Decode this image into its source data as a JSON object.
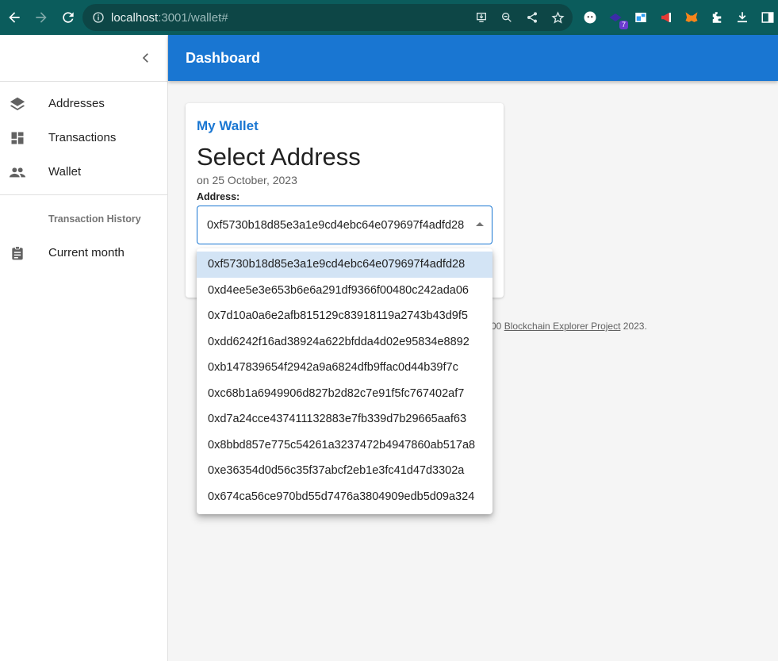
{
  "browser": {
    "url_host": "localhost",
    "url_rest": ":3001/wallet#",
    "extension_badge": "7"
  },
  "sidebar": {
    "items": [
      {
        "label": "Addresses",
        "icon": "layers-icon"
      },
      {
        "label": "Transactions",
        "icon": "dashboard-icon"
      },
      {
        "label": "Wallet",
        "icon": "people-icon"
      }
    ],
    "subheader": "Transaction History",
    "history_items": [
      {
        "label": "Current month",
        "icon": "assignment-icon"
      }
    ]
  },
  "appbar": {
    "title": "Dashboard"
  },
  "card": {
    "title": "My Wallet",
    "heading": "Select Address",
    "date": "on 25 October, 2023",
    "field_label": "Address:",
    "selected_address": "0xf5730b18d85e3a1e9cd4ebc64e079697f4adfd28"
  },
  "footer": {
    "prefix": "00",
    "link": "Blockchain Explorer Project",
    "suffix": "2023."
  },
  "dropdown": {
    "options": [
      "0xf5730b18d85e3a1e9cd4ebc64e079697f4adfd28",
      "0xd4ee5e3e653b6e6a291df9366f00480c242ada06",
      "0x7d10a0a6e2afb815129c83918119a2743b43d9f5",
      "0xdd6242f16ad38924a622bfdda4d02e95834e8892",
      "0xb147839654f2942a9a6824dfb9ffac0d44b39f7c",
      "0xc68b1a6949906d827b2d82c7e91f5fc767402af7",
      "0xd7a24cce437411132883e7fb339d7b29665aaf63",
      "0x8bbd857e775c54261a3237472b4947860ab517a8",
      "0xe36354d0d56c35f37abcf2eb1e3fc41d47d3302a",
      "0x674ca56ce970bd55d7476a3804909edb5d09a324"
    ]
  },
  "colors": {
    "primary": "#1976d2",
    "browser_bar": "#0b5c5c",
    "selected_option": "#d3e4f5"
  }
}
